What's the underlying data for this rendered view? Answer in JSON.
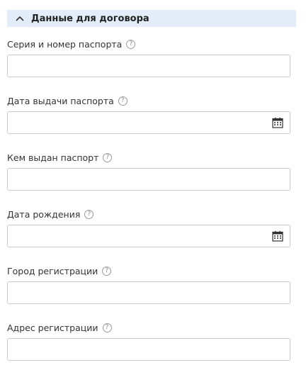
{
  "section": {
    "title": "Данные для договора",
    "expanded": true,
    "accent_color": "#e3edf9"
  },
  "fields": {
    "passport_number": {
      "label": "Серия и номер паспорта",
      "value": ""
    },
    "passport_issue_date": {
      "label": "Дата выдачи паспорта",
      "value": ""
    },
    "passport_issued_by": {
      "label": "Кем выдан паспорт",
      "value": ""
    },
    "birth_date": {
      "label": "Дата рождения",
      "value": ""
    },
    "registration_city": {
      "label": "Город регистрации",
      "value": ""
    },
    "registration_address": {
      "label": "Адрес регистрации",
      "value": ""
    }
  },
  "help_glyph": "?"
}
